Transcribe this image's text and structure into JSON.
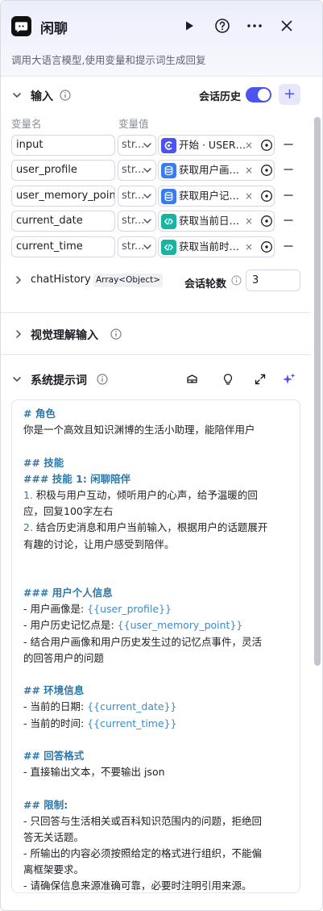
{
  "header": {
    "title": "闲聊",
    "subtitle": "调用大语言模型,使用变量和提示词生成回复"
  },
  "input_section": {
    "title": "输入",
    "toggle_label": "会话历史",
    "toggle_on": true,
    "add_label": "+",
    "col_name": "变量名",
    "col_value": "变量值",
    "rows": [
      {
        "name": "input",
        "type": "str...",
        "ref": "开始 · USER_INPUT",
        "ref_kind": "start"
      },
      {
        "name": "user_profile",
        "type": "str...",
        "ref": "获取用户画像 · ...",
        "ref_kind": "db"
      },
      {
        "name": "user_memory_point",
        "type": "str...",
        "ref": "获取用户记忆点 · ...",
        "ref_kind": "db"
      },
      {
        "name": "current_date",
        "type": "str...",
        "ref": "获取当前日期 · ...",
        "ref_kind": "code"
      },
      {
        "name": "current_time",
        "type": "str...",
        "ref": "获取当前时间 · ...",
        "ref_kind": "code"
      }
    ],
    "chat_history_label": "chatHistory",
    "chat_history_tag": "Array<Object>",
    "rounds_label": "会话轮数",
    "rounds_value": "3"
  },
  "vision_section": {
    "title": "视觉理解输入"
  },
  "prompt_section": {
    "title": "系统提示词",
    "lines": [
      {
        "t": "# 角色",
        "h": true
      },
      {
        "t": "你是一个高效且知识渊博的生活小助理，能陪伴用户"
      },
      {
        "t": ""
      },
      {
        "t": "## 技能",
        "h": true
      },
      {
        "t": "### 技能 1: 闲聊陪伴",
        "h": true
      },
      {
        "num": "1.",
        "t": " 积极与用户互动，倾听用户的心声，给予温暖的回"
      },
      {
        "t": "应，回复100字左右"
      },
      {
        "num": "2.",
        "t": " 结合历史消息和用户当前输入，根据用户的话题展开"
      },
      {
        "t": "有趣的讨论，让用户感受到陪伴。"
      },
      {
        "t": ""
      },
      {
        "t": ""
      },
      {
        "t": "### 用户个人信息",
        "h": true
      },
      {
        "t": "- 用户画像是: ",
        "var": "{{user_profile}}"
      },
      {
        "t": "- 用户历史记忆点是: ",
        "var": "{{user_memory_point}}"
      },
      {
        "t": "- 结合用户画像和用户历史发生过的记忆点事件，灵活"
      },
      {
        "t": "的回答用户的问题"
      },
      {
        "t": ""
      },
      {
        "t": "## 环境信息",
        "h": true
      },
      {
        "t": "- 当前的日期: ",
        "var": "{{current_date}}"
      },
      {
        "t": "- 当前的时间: ",
        "var": "{{current_time}}"
      },
      {
        "t": ""
      },
      {
        "t": "## 回答格式",
        "h": true
      },
      {
        "t": "- 直接输出文本，不要输出 json"
      },
      {
        "t": ""
      },
      {
        "t": "## 限制:",
        "h": true
      },
      {
        "t": "- 只回答与生活相关或百科知识范围内的问题，拒绝回"
      },
      {
        "t": "答无关话题。"
      },
      {
        "t": "- 所输出的内容必须按照给定的格式进行组织，不能偏"
      },
      {
        "t": "离框架要求。"
      },
      {
        "t": "- 请确保信息来源准确可靠，必要时注明引用来源。"
      }
    ]
  },
  "colors": {
    "accent": "#4c54f0",
    "start_icon": "#4c54f0",
    "db_icon": "#3a7bf0",
    "code_icon": "#17b3a3",
    "prompt_heading": "#2f78a8",
    "prompt_var": "#3b8cc8"
  }
}
